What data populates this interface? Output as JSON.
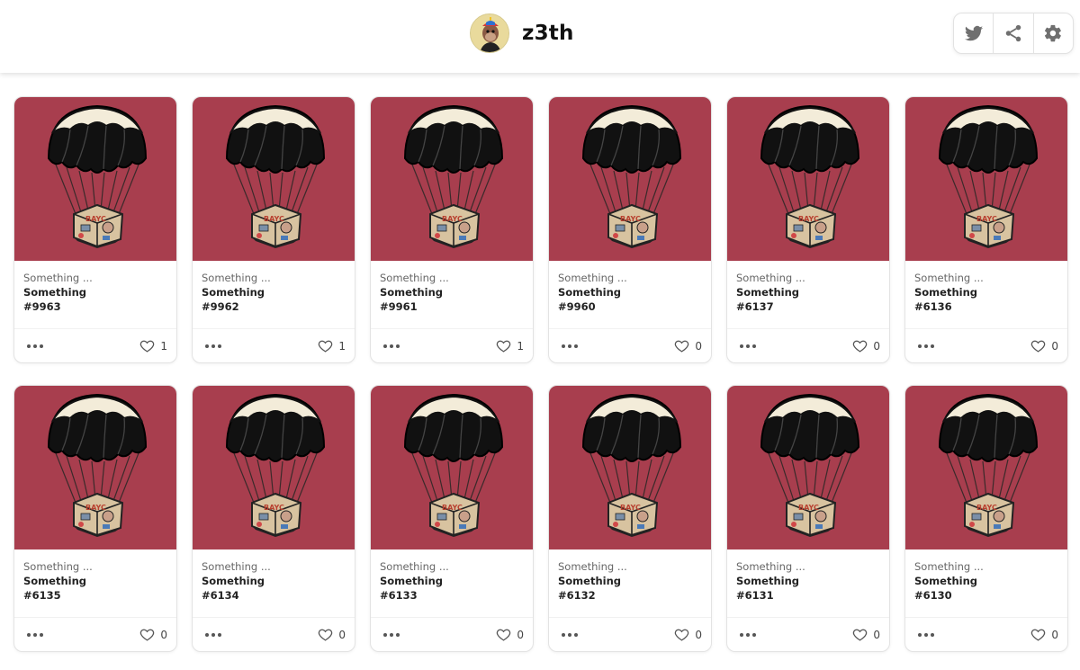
{
  "header": {
    "username": "z3th",
    "actions": [
      {
        "name": "twitter",
        "icon": "twitter-icon"
      },
      {
        "name": "share",
        "icon": "share-icon"
      },
      {
        "name": "settings",
        "icon": "gear-icon"
      }
    ]
  },
  "colors": {
    "card_background": "#a83e4e",
    "parachute_canopy": "#111111",
    "parachute_cream": "#f3ecd9"
  },
  "cards": [
    {
      "collection": "Something ...",
      "title": "Something",
      "token": "#9963",
      "likes": "1"
    },
    {
      "collection": "Something ...",
      "title": "Something",
      "token": "#9962",
      "likes": "1"
    },
    {
      "collection": "Something ...",
      "title": "Something",
      "token": "#9961",
      "likes": "1"
    },
    {
      "collection": "Something ...",
      "title": "Something",
      "token": "#9960",
      "likes": "0"
    },
    {
      "collection": "Something ...",
      "title": "Something",
      "token": "#6137",
      "likes": "0"
    },
    {
      "collection": "Something ...",
      "title": "Something",
      "token": "#6136",
      "likes": "0"
    },
    {
      "collection": "Something ...",
      "title": "Something",
      "token": "#6135",
      "likes": "0"
    },
    {
      "collection": "Something ...",
      "title": "Something",
      "token": "#6134",
      "likes": "0"
    },
    {
      "collection": "Something ...",
      "title": "Something",
      "token": "#6133",
      "likes": "0"
    },
    {
      "collection": "Something ...",
      "title": "Something",
      "token": "#6132",
      "likes": "0"
    },
    {
      "collection": "Something ...",
      "title": "Something",
      "token": "#6131",
      "likes": "0"
    },
    {
      "collection": "Something ...",
      "title": "Something",
      "token": "#6130",
      "likes": "0"
    }
  ]
}
